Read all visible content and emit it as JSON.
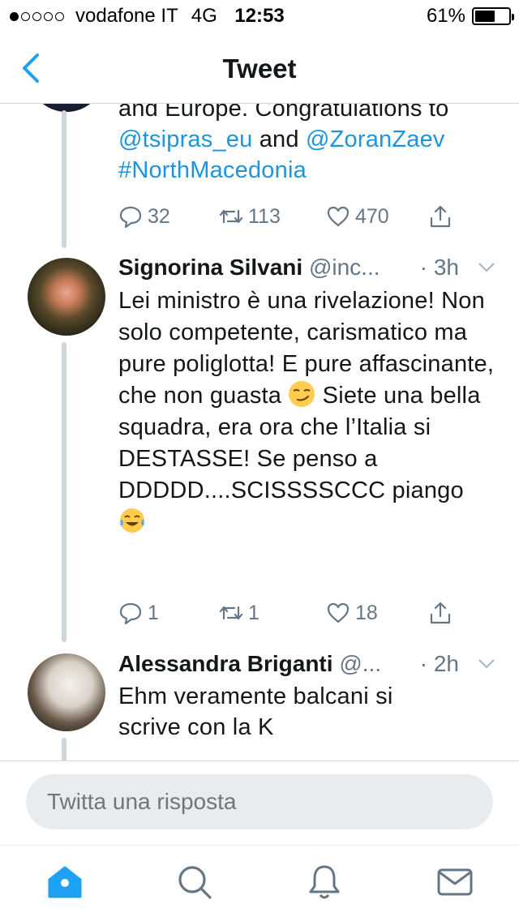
{
  "status_bar": {
    "carrier": "vodafone IT",
    "network": "4G",
    "time": "12:53",
    "battery_percent": "61%",
    "battery_level": 0.61,
    "signal_bars_filled": 1,
    "signal_bars_total": 5
  },
  "nav": {
    "title": "Tweet"
  },
  "colors": {
    "link": "#1b95e0",
    "secondary_text": "#657786",
    "thread_line": "#ccd6dd",
    "active_tab": "#1da1f2"
  },
  "tweets": [
    {
      "text_line1": "and Europe. Congratulations to",
      "mention1": "@tsipras_eu",
      "conjunction": " and ",
      "mention2": "@ZoranZaev",
      "hashtag": "#NorthMacedonia",
      "replies": "32",
      "retweets": "113",
      "likes": "470"
    },
    {
      "name": "Signorina Silvani",
      "handle": "@inc...",
      "time": "· 3h",
      "text_part1": "Lei ministro è una rivelazione! Non solo competente, carismatico ma pure poliglotta! E pure affascinante, che non guasta",
      "emoji1": "smirking-face-emoji",
      "text_part2": " Siete una bella squadra, era ora che l’Italia si DESTASSE! Se penso a DDDDD....SCISSSSCCC piango",
      "emoji2": "tears-of-joy-emoji",
      "replies": "1",
      "retweets": "1",
      "likes": "18"
    },
    {
      "name": "Alessandra Briganti",
      "handle": "@...",
      "time": "· 2h",
      "text": "Ehm veramente balcani si scrive con la K"
    }
  ],
  "reply": {
    "placeholder": "Twitta una risposta"
  },
  "tabs": [
    "home-icon",
    "search-icon",
    "notifications-bell-icon",
    "messages-envelope-icon"
  ]
}
